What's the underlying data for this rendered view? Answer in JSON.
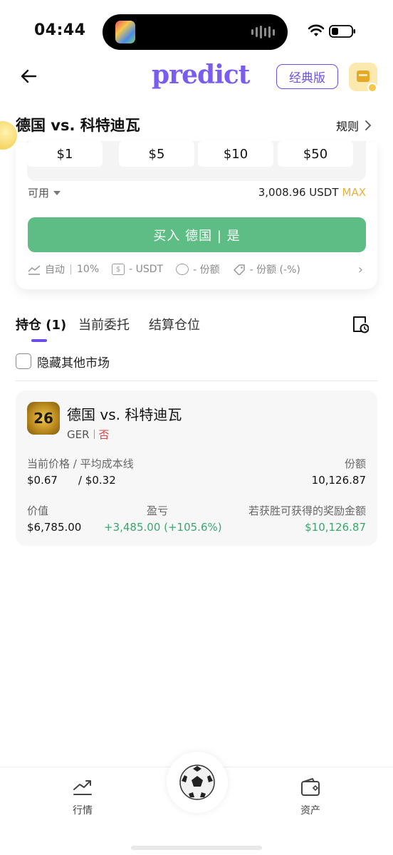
{
  "status": {
    "time": "04:44"
  },
  "header": {
    "logo": "predict",
    "classic_label": "经典版"
  },
  "market": {
    "title": "德国 vs. 科特迪瓦",
    "rules_label": "规则"
  },
  "trade": {
    "amounts": [
      "$1",
      "$5",
      "$10",
      "$50"
    ],
    "available_label": "可用",
    "available_value": "3,008.96 USDT",
    "max_label": "MAX",
    "buy_label": "买入 德国 | 是",
    "meta": {
      "auto_label": "自动",
      "slippage": "10%",
      "usdt": "- USDT",
      "shares": "- 份额",
      "shares_pct": "- 份额 (-%)"
    }
  },
  "tabs": {
    "positions": "持仓 (1)",
    "orders": "当前委托",
    "settled": "结算仓位"
  },
  "hide_other_label": "隐藏其他市场",
  "position": {
    "avatar_text": "26",
    "title": "德国 vs. 科特迪瓦",
    "code": "GER",
    "side": "否",
    "price_label": "当前价格 / 平均成本线",
    "current_price": "$0.67",
    "avg_cost": "/ $0.32",
    "shares_label": "份额",
    "shares_value": "10,126.87",
    "value_label": "价值",
    "value": "$6,785.00",
    "pnl_label": "盈亏",
    "pnl": "+3,485.00 (+105.6%)",
    "reward_label": "若获胜可获得的奖励金额",
    "reward": "$10,126.87"
  },
  "bottom_nav": {
    "market_label": "行情",
    "assets_label": "资产"
  },
  "colors": {
    "brand": "#7b5cf0",
    "buy_green": "#5ebd84",
    "profit_green": "#3aa76d",
    "no_red": "#d9434a",
    "max_yellow": "#e5b23a"
  }
}
